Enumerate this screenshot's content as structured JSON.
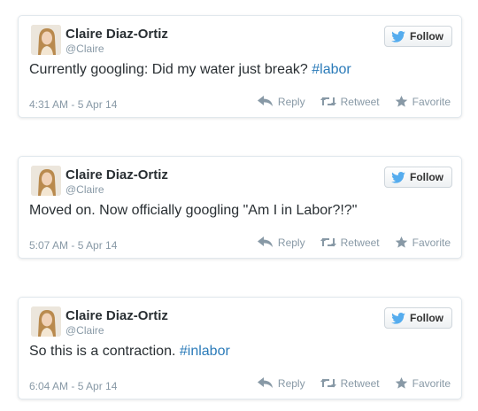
{
  "colors": {
    "accent": "#2b7bb9",
    "bird": "#55acee",
    "muted": "#8899a6",
    "text": "#292f33"
  },
  "follow_icon": "twitter-bird-icon",
  "action_icons": [
    "reply-arrow-icon",
    "retweet-icon",
    "star-icon"
  ],
  "tweets": [
    {
      "name": "Claire Diaz-Ortiz",
      "handle": "@Claire",
      "follow_label": "Follow",
      "text_before": "Currently googling: Did my water just break? ",
      "hashtag": "#labor",
      "timestamp": "4:31 AM - 5 Apr 14",
      "reply_label": "Reply",
      "retweet_label": "Retweet",
      "favorite_label": "Favorite"
    },
    {
      "name": "Claire Diaz-Ortiz",
      "handle": "@Claire",
      "follow_label": "Follow",
      "text_before": "Moved on. Now officially googling \"Am I in Labor?!?\"",
      "hashtag": "",
      "timestamp": "5:07 AM - 5 Apr 14",
      "reply_label": "Reply",
      "retweet_label": "Retweet",
      "favorite_label": "Favorite"
    },
    {
      "name": "Claire Diaz-Ortiz",
      "handle": "@Claire",
      "follow_label": "Follow",
      "text_before": "So this is a contraction. ",
      "hashtag": "#inlabor",
      "timestamp": "6:04 AM - 5 Apr 14",
      "reply_label": "Reply",
      "retweet_label": "Retweet",
      "favorite_label": "Favorite"
    }
  ]
}
